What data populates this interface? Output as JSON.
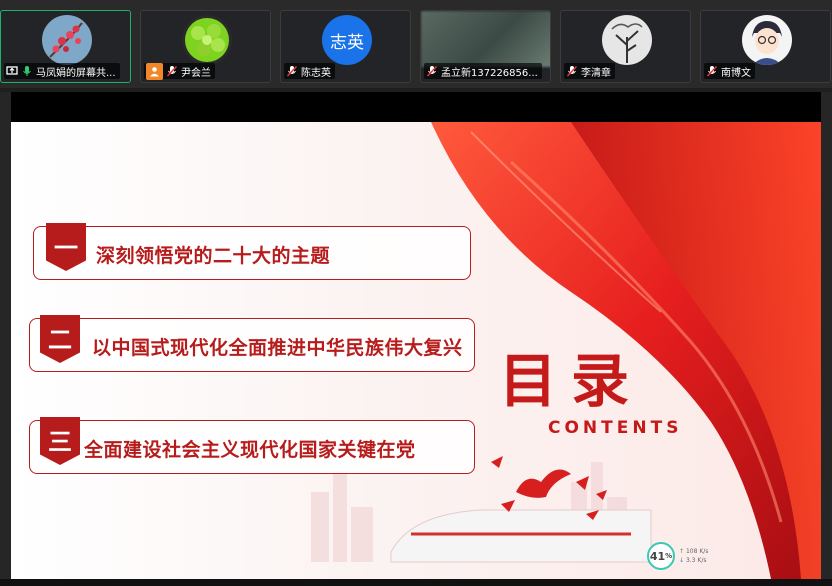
{
  "participants": [
    {
      "name": "马凤娟的屏幕共...",
      "avatar": "plum-blossom-photo",
      "status_icon": "screen-share-icon",
      "mic": "mic-on-icon",
      "active": true
    },
    {
      "name": "尹会兰",
      "avatar": "green-succulent-photo",
      "status_icon": "host-icon",
      "mic": "mic-muted-icon",
      "active": false
    },
    {
      "name": "陈志英",
      "avatar_text": "志英",
      "avatar": "text-avatar",
      "mic": "mic-muted-icon",
      "active": false
    },
    {
      "name": "孟立新137226856...",
      "avatar": "blurred-video",
      "mic": "mic-muted-icon",
      "active": false
    },
    {
      "name": "李清章",
      "avatar": "ink-tree-photo",
      "mic": "mic-muted-icon",
      "active": false
    },
    {
      "name": "南博文",
      "avatar": "cartoon-boy-photo",
      "mic": "mic-muted-icon",
      "active": false
    }
  ],
  "slide": {
    "title": "目录",
    "subtitle": "CONTENTS",
    "items": [
      {
        "num": "一",
        "text": "深刻领悟党的二十大的主题"
      },
      {
        "num": "二",
        "text": "以中国式现代化全面推进中华民族伟大复兴"
      },
      {
        "num": "三",
        "text": "全面建设社会主义现代化国家关键在党"
      }
    ]
  },
  "network": {
    "percent": "41",
    "unit": "%",
    "up": "108 K/s",
    "down": "3.3 K/s"
  },
  "colors": {
    "accent": "#c41a1a",
    "active_border": "#1fb26b",
    "avatar_blue": "#1a73e8"
  }
}
